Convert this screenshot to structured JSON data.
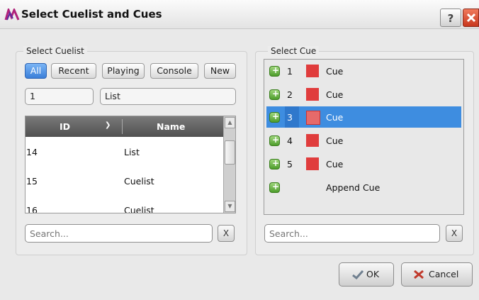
{
  "window": {
    "title": "Select Cuelist and Cues",
    "help_label": "?"
  },
  "cuelist_panel": {
    "legend": "Select Cuelist",
    "filters": [
      {
        "label": "All",
        "active": true
      },
      {
        "label": "Recent",
        "active": false
      },
      {
        "label": "Playing",
        "active": false
      },
      {
        "label": "Console",
        "active": false
      },
      {
        "label": "New",
        "active": false
      }
    ],
    "selected_id": "1",
    "selected_name": "List",
    "table": {
      "columns": [
        "ID",
        "Name"
      ],
      "rows": [
        {
          "id": "14",
          "name": "List"
        },
        {
          "id": "15",
          "name": "Cuelist"
        },
        {
          "id": "16",
          "name": "Cuelist"
        }
      ]
    },
    "search_placeholder": "Search...",
    "clear_label": "X"
  },
  "cue_panel": {
    "legend": "Select Cue",
    "cues": [
      {
        "num": "1",
        "text": "Cue",
        "color": "#e03c3c",
        "selected": false
      },
      {
        "num": "2",
        "text": "Cue",
        "color": "#e03c3c",
        "selected": false
      },
      {
        "num": "3",
        "text": "Cue",
        "color": "#e66a6a",
        "selected": true
      },
      {
        "num": "4",
        "text": "Cue",
        "color": "#e03c3c",
        "selected": false
      },
      {
        "num": "5",
        "text": "Cue",
        "color": "#e03c3c",
        "selected": false
      },
      {
        "num": "",
        "text": "Append Cue",
        "color": "",
        "selected": false
      }
    ],
    "search_placeholder": "Search...",
    "clear_label": "X"
  },
  "footer": {
    "ok_label": "OK",
    "cancel_label": "Cancel"
  },
  "colors": {
    "accent": "#3e8de0",
    "cue_red": "#e03c3c",
    "add_green": "#4d9d2b"
  }
}
